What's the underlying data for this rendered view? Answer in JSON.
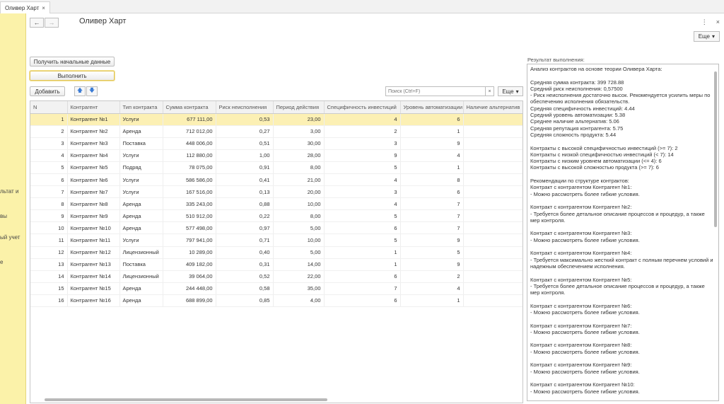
{
  "tab": {
    "title": "Оливер Харт",
    "close": "×"
  },
  "sidebar": {
    "items": [
      "льтат и",
      "вы",
      "ый учет",
      "е"
    ]
  },
  "header": {
    "title": "Оливер Харт",
    "more": "Еще",
    "menu_icon": "⋮",
    "close_icon": "×"
  },
  "buttons": {
    "get_data": "Получить начальные данные",
    "execute": "Выполнить",
    "add": "Добавить"
  },
  "search": {
    "placeholder": "Поиск (Ctrl+F)",
    "clear": "×",
    "more": "Еще"
  },
  "table": {
    "columns": [
      "N",
      "Контрагент",
      "Тип контракта",
      "Сумма контракта",
      "Риск неисполнения",
      "Период действия",
      "Специфичность инвестиций",
      "Уровень автоматизации",
      "Наличие альтернатив"
    ],
    "rows": [
      [
        "1",
        "Контрагент №1",
        "Услуги",
        "677 111,00",
        "0,53",
        "23,00",
        "4",
        "6"
      ],
      [
        "2",
        "Контрагент №2",
        "Аренда",
        "712 012,00",
        "0,27",
        "3,00",
        "2",
        "1"
      ],
      [
        "3",
        "Контрагент №3",
        "Поставка",
        "448 006,00",
        "0,51",
        "30,00",
        "3",
        "9"
      ],
      [
        "4",
        "Контрагент №4",
        "Услуги",
        "112 880,00",
        "1,00",
        "28,00",
        "9",
        "4"
      ],
      [
        "5",
        "Контрагент №5",
        "Подряд",
        "78 075,00",
        "0,91",
        "8,00",
        "5",
        "1"
      ],
      [
        "6",
        "Контрагент №6",
        "Услуги",
        "586 586,00",
        "0,41",
        "21,00",
        "4",
        "8"
      ],
      [
        "7",
        "Контрагент №7",
        "Услуги",
        "167 516,00",
        "0,13",
        "20,00",
        "3",
        "6"
      ],
      [
        "8",
        "Контрагент №8",
        "Аренда",
        "335 243,00",
        "0,88",
        "10,00",
        "4",
        "7"
      ],
      [
        "9",
        "Контрагент №9",
        "Аренда",
        "510 912,00",
        "0,22",
        "8,00",
        "5",
        "7"
      ],
      [
        "10",
        "Контрагент №10",
        "Аренда",
        "577 498,00",
        "0,97",
        "5,00",
        "6",
        "7"
      ],
      [
        "11",
        "Контрагент №11",
        "Услуги",
        "797 941,00",
        "0,71",
        "10,00",
        "5",
        "9"
      ],
      [
        "12",
        "Контрагент №12",
        "Лицензионный",
        "10 289,00",
        "0,40",
        "5,00",
        "1",
        "5"
      ],
      [
        "13",
        "Контрагент №13",
        "Поставка",
        "409 182,00",
        "0,31",
        "14,00",
        "1",
        "9"
      ],
      [
        "14",
        "Контрагент №14",
        "Лицензионный",
        "39 064,00",
        "0,52",
        "22,00",
        "6",
        "2"
      ],
      [
        "15",
        "Контрагент №15",
        "Аренда",
        "244 448,00",
        "0,58",
        "35,00",
        "7",
        "4"
      ],
      [
        "16",
        "Контрагент №16",
        "Аренда",
        "688 899,00",
        "0,85",
        "4,00",
        "6",
        "1"
      ]
    ]
  },
  "result": {
    "label": "Результат выполнения:",
    "lines": [
      "Анализ контрактов на основе теории Оливера Харта:",
      "",
      "Средняя сумма контракта: 399 728.88",
      "Средний риск неисполнения: 0,57500",
      "- Риск неисполнения достаточно высок. Рекомендуется усилить меры по обеспечению исполнения обязательств.",
      "Средняя специфичность инвестиций: 4.44",
      "Средний уровень автоматизации: 5.38",
      "Среднее наличие альтернатив: 5.06",
      "Средняя репутация контрагента: 5.75",
      "Средняя сложность продукта: 5.44",
      "",
      "Контракты с высокой специфичностью инвестиций (>= 7): 2",
      "Контракты с низкой специфичностью инвестиций (< 7): 14",
      "Контракты с низким уровнем автоматизации (<= 4): 6",
      "Контракты с высокой сложностью продукта (>= 7): 6",
      "",
      "Рекомендации по структуре контрактов:",
      "Контракт с контрагентом Контрагент №1:",
      "- Можно рассмотреть более гибкие условия.",
      "",
      "Контракт с контрагентом Контрагент №2:",
      "- Требуется более детальное описание процессов и процедур, а также мер контроля.",
      "",
      "Контракт с контрагентом Контрагент №3:",
      "- Можно рассмотреть более гибкие условия.",
      "",
      "Контракт с контрагентом Контрагент №4:",
      "- Требуется максимально жесткий контракт с полным перечнем условий и надежным обеспечением исполнения.",
      "",
      "Контракт с контрагентом Контрагент №5:",
      "- Требуется более детальное описание процессов и процедур, а также мер контроля.",
      "",
      "Контракт с контрагентом Контрагент №6:",
      "- Можно рассмотреть более гибкие условия.",
      "",
      "Контракт с контрагентом Контрагент №7:",
      "- Можно рассмотреть более гибкие условия.",
      "",
      "Контракт с контрагентом Контрагент №8:",
      "- Можно рассмотреть более гибкие условия.",
      "",
      "Контракт с контрагентом Контрагент №9:",
      "- Можно рассмотреть более гибкие условия.",
      "",
      "Контракт с контрагентом Контрагент №10:",
      "- Можно рассмотреть более гибкие условия."
    ]
  }
}
